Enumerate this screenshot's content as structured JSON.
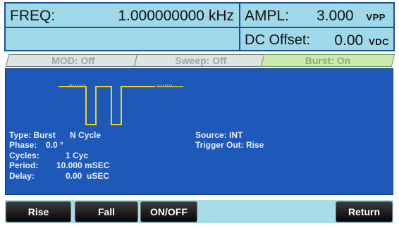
{
  "freq": {
    "label": "FREQ:",
    "value": "1.000000000 kHz"
  },
  "ampl": {
    "label": "AMPL:",
    "value": "3.000",
    "unit": "VPP"
  },
  "offset": {
    "label": "DC Offset:",
    "value": "0.00",
    "unit": "VDC"
  },
  "tabs": [
    {
      "label": "MOD: Off"
    },
    {
      "label": "Sweep: Off"
    },
    {
      "label": "Burst: On"
    }
  ],
  "info_left": [
    {
      "key": "Type: Burst",
      "value": "N Cycle"
    },
    {
      "key": "Phase:",
      "value": "0.0 °"
    },
    {
      "key": "Cycles:",
      "value": "1 Cyc"
    },
    {
      "key": "Period:",
      "value": "10.000 mSEC"
    },
    {
      "key": "Delay:",
      "value": "0.00  uSEC"
    }
  ],
  "info_right": [
    {
      "text": "Source: INT"
    },
    {
      "text": "Trigger Out: Rise"
    }
  ],
  "softkeys": [
    {
      "label": "Rise"
    },
    {
      "label": "Fall"
    },
    {
      "label": "ON/OFF"
    },
    {
      "label": "Return"
    }
  ],
  "colors": {
    "waveform": "#f2d21c",
    "panel": "#1e58b8",
    "header_box": "#9fd8e8"
  }
}
